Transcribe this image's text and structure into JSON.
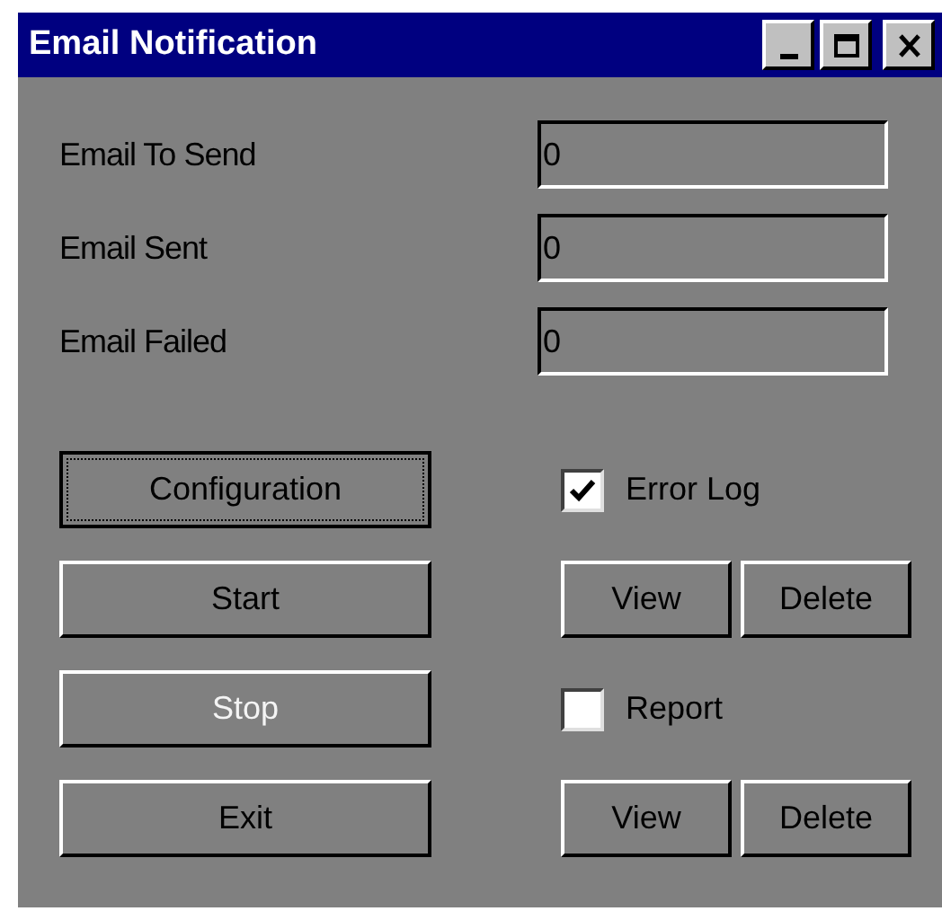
{
  "window": {
    "title": "Email Notification"
  },
  "counters": [
    {
      "label": "Email To Send",
      "value": "0"
    },
    {
      "label": "Email Sent",
      "value": "0"
    },
    {
      "label": "Email Failed",
      "value": "0"
    }
  ],
  "actions": [
    {
      "label": "Configuration",
      "default": true,
      "disabled": false
    },
    {
      "label": "Start",
      "default": false,
      "disabled": false
    },
    {
      "label": "Stop",
      "default": false,
      "disabled": true
    },
    {
      "label": "Exit",
      "default": false,
      "disabled": false
    }
  ],
  "logs": [
    {
      "label": "Error Log",
      "checked": true,
      "buttons": [
        {
          "label": "View"
        },
        {
          "label": "Delete"
        }
      ]
    },
    {
      "label": "Report",
      "checked": false,
      "buttons": [
        {
          "label": "View"
        },
        {
          "label": "Delete"
        }
      ]
    }
  ]
}
